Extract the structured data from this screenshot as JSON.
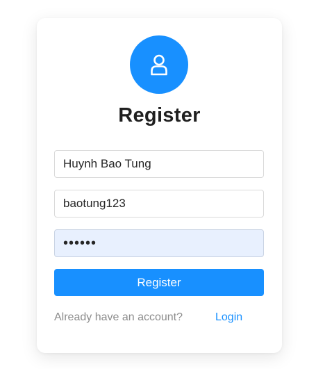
{
  "form": {
    "title": "Register",
    "icon": "user-icon",
    "accent_color": "#1890ff",
    "fields": [
      {
        "name": "fullname",
        "value": "Huynh Bao Tung"
      },
      {
        "name": "username",
        "value": "baotung123"
      },
      {
        "name": "password",
        "value": "••••••"
      }
    ],
    "submit_label": "Register",
    "footer_text": "Already have an account?",
    "login_link": "Login"
  }
}
